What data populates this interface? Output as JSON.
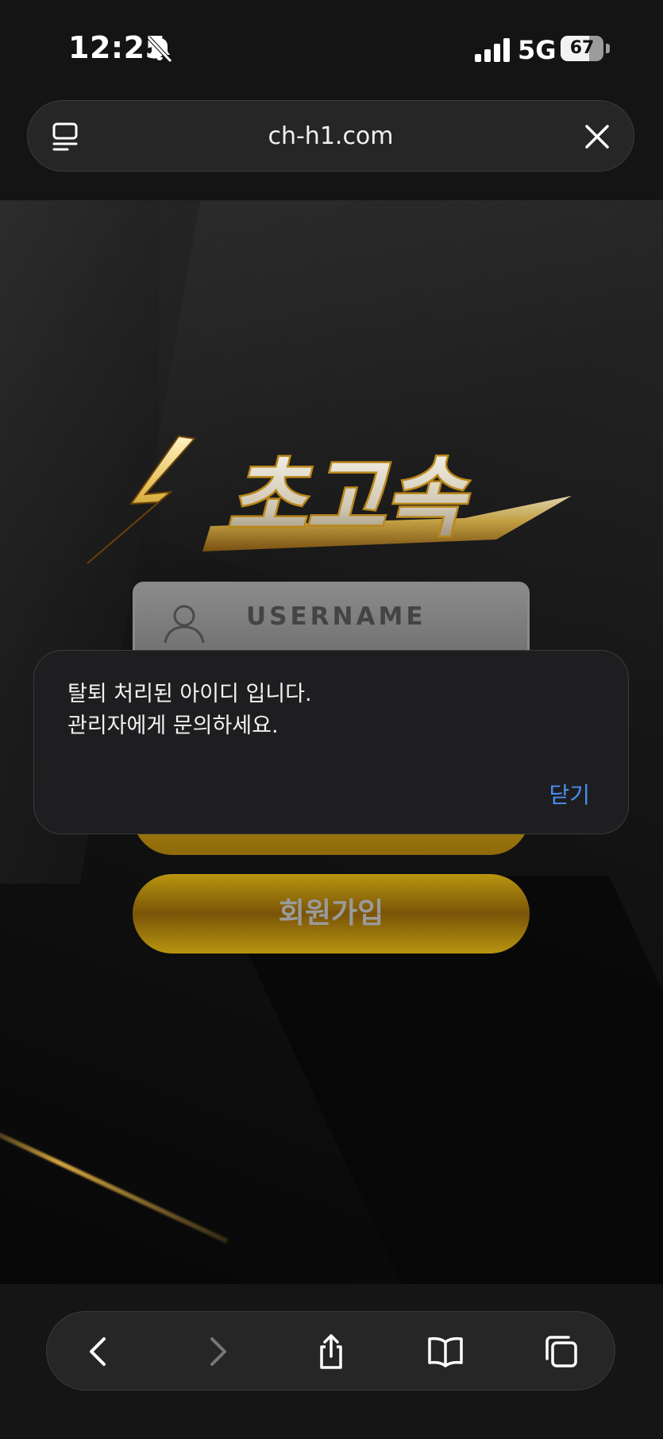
{
  "status_bar": {
    "time": "12:25",
    "network": "5G",
    "battery": "67",
    "battery_level": 0.67
  },
  "browser": {
    "url": "ch-h1.com"
  },
  "login_page": {
    "logo_text": "초고속",
    "username_placeholder": "USERNAME",
    "signup_label": "회원가입",
    "accent_color": "#b8950f"
  },
  "alert": {
    "line1": "탈퇴 처리된 아이디 입니다.",
    "line2": "관리자에게 문의하세요.",
    "close_label": "닫기",
    "close_color": "#4a8ef0"
  },
  "toolbar": {
    "icons": [
      "back-icon",
      "forward-icon",
      "share-icon",
      "bookmarks-icon",
      "tabs-icon"
    ]
  }
}
